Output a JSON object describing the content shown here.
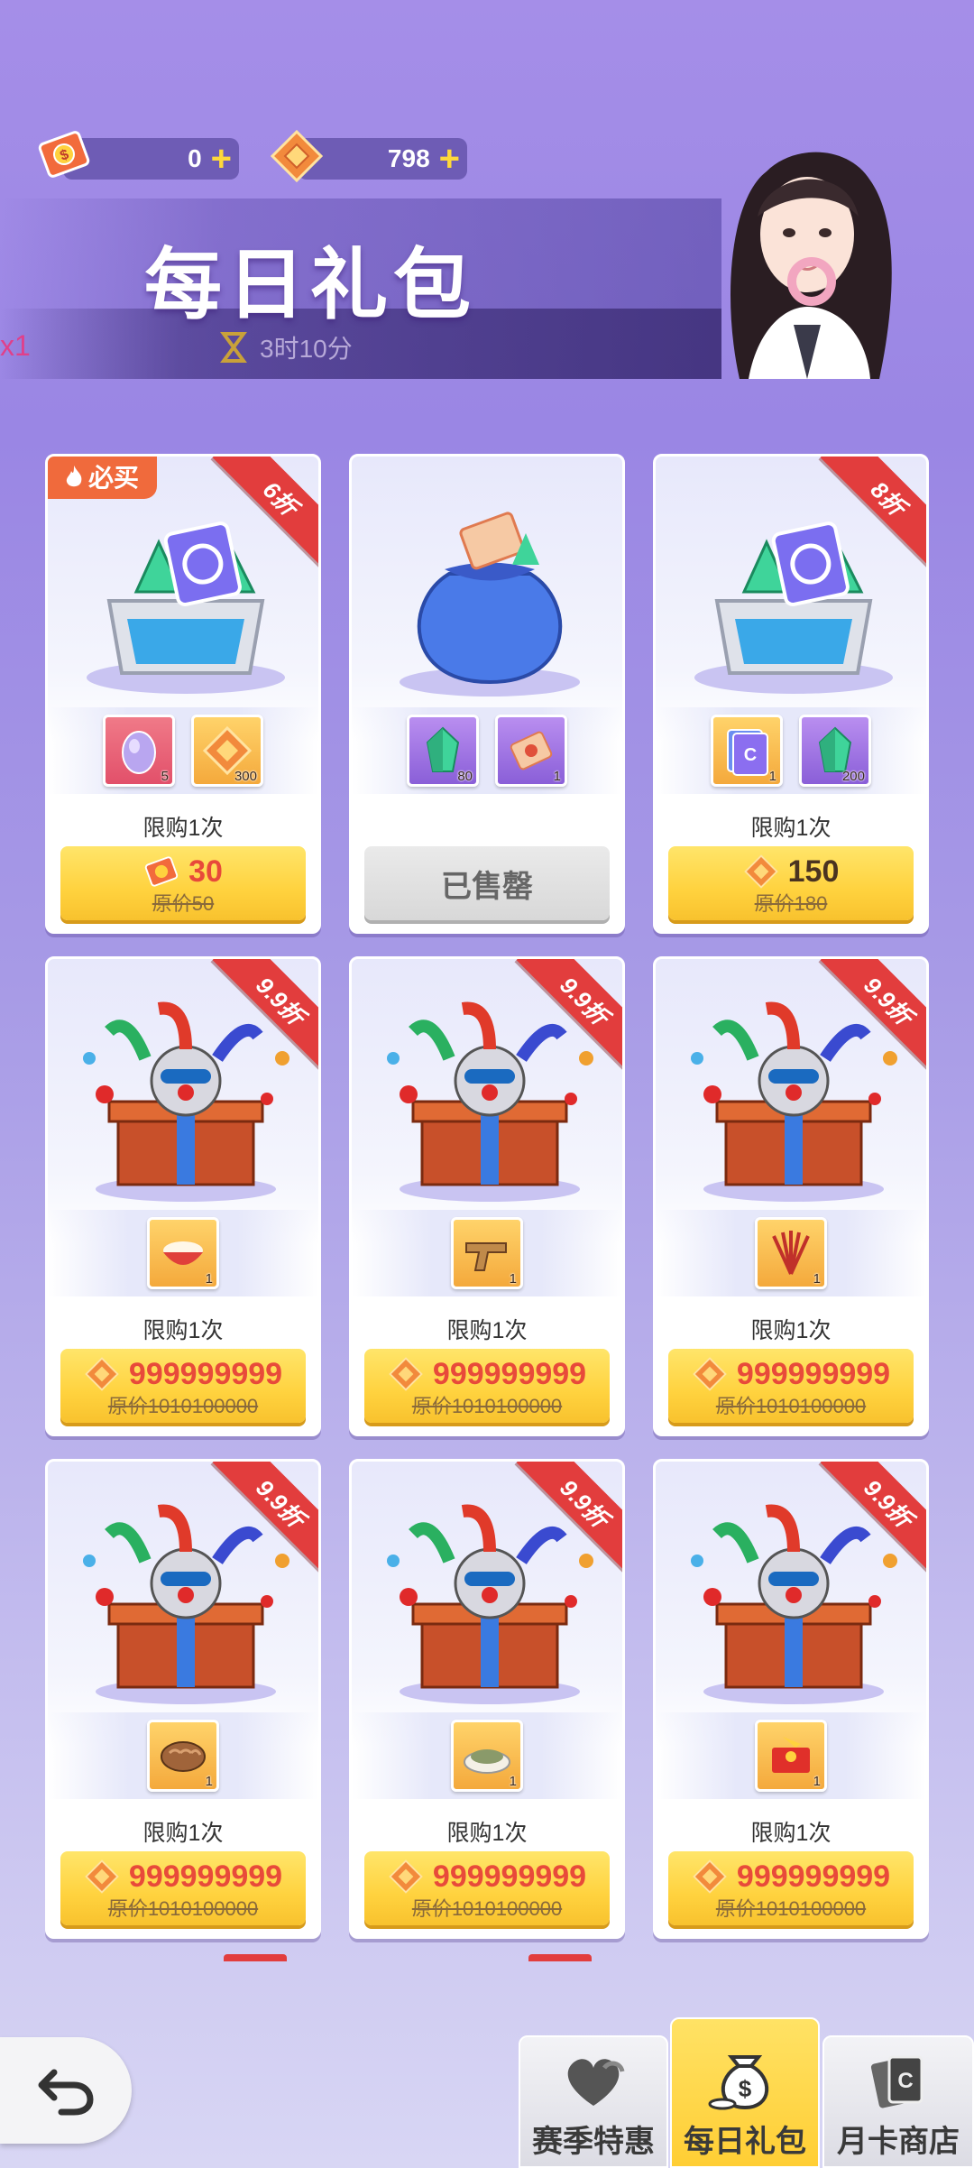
{
  "header": {
    "title": "每日礼包",
    "timer": "3时10分",
    "side_text": "x1",
    "currencies": [
      {
        "icon": "ticket-coin-icon",
        "value": "0"
      },
      {
        "icon": "diamond-coin-icon",
        "value": "798"
      }
    ],
    "plus_symbol": "+"
  },
  "cards": [
    {
      "badge": "必买",
      "discount": "6折",
      "art": "crystal-chest",
      "items": [
        {
          "icon": "egg-icon",
          "qty": "5",
          "bg": "red"
        },
        {
          "icon": "diamond-coin-icon",
          "qty": "300",
          "bg": "orange"
        }
      ],
      "limit": "限购1次",
      "price": "30",
      "currency": "ticket",
      "original": "原价50",
      "sold": false
    },
    {
      "badge": "",
      "discount": "",
      "art": "blue-bag",
      "items": [
        {
          "icon": "green-crystal-icon",
          "qty": "80",
          "bg": "purple"
        },
        {
          "icon": "ticket-icon",
          "qty": "1",
          "bg": "purple"
        }
      ],
      "limit": "",
      "price": "",
      "currency": "",
      "original": "",
      "sold": true,
      "sold_label": "已售罄"
    },
    {
      "badge": "",
      "discount": "8折",
      "art": "crystal-chest",
      "items": [
        {
          "icon": "card-pack-icon",
          "qty": "1",
          "bg": "orange"
        },
        {
          "icon": "green-crystal-icon",
          "qty": "200",
          "bg": "purple"
        }
      ],
      "limit": "限购1次",
      "price": "150",
      "currency": "diamond",
      "original": "原价180",
      "sold": false
    },
    {
      "badge": "",
      "discount": "9.9折",
      "art": "clown-gift",
      "items": [
        {
          "icon": "rice-bowl-icon",
          "qty": "1",
          "bg": "orange"
        }
      ],
      "limit": "限购1次",
      "price": "999999999",
      "currency": "diamond",
      "original": "原价1010100000",
      "sold": false
    },
    {
      "badge": "",
      "discount": "9.9折",
      "art": "clown-gift",
      "items": [
        {
          "icon": "pistol-icon",
          "qty": "1",
          "bg": "orange"
        }
      ],
      "limit": "限购1次",
      "price": "999999999",
      "currency": "diamond",
      "original": "原价1010100000",
      "sold": false
    },
    {
      "badge": "",
      "discount": "9.9折",
      "art": "clown-gift",
      "items": [
        {
          "icon": "feather-fan-icon",
          "qty": "1",
          "bg": "orange"
        }
      ],
      "limit": "限购1次",
      "price": "999999999",
      "currency": "diamond",
      "original": "原价1010100000",
      "sold": false
    },
    {
      "badge": "",
      "discount": "9.9折",
      "art": "clown-gift",
      "items": [
        {
          "icon": "bread-icon",
          "qty": "1",
          "bg": "orange"
        }
      ],
      "limit": "限购1次",
      "price": "999999999",
      "currency": "diamond",
      "original": "原价1010100000",
      "sold": false
    },
    {
      "badge": "",
      "discount": "9.9折",
      "art": "clown-gift",
      "items": [
        {
          "icon": "fish-dish-icon",
          "qty": "1",
          "bg": "orange"
        }
      ],
      "limit": "限购1次",
      "price": "999999999",
      "currency": "diamond",
      "original": "原价1010100000",
      "sold": false
    },
    {
      "badge": "",
      "discount": "9.9折",
      "art": "clown-gift",
      "items": [
        {
          "icon": "red-envelope-icon",
          "qty": "1",
          "bg": "orange"
        }
      ],
      "limit": "限购1次",
      "price": "999999999",
      "currency": "diamond",
      "original": "原价1010100000",
      "sold": false
    }
  ],
  "bottom_nav": {
    "back_icon": "back-arrow-icon",
    "tabs": [
      {
        "label": "赛季特惠",
        "icon": "heart-stack-icon",
        "active": false
      },
      {
        "label": "每日礼包",
        "icon": "money-bag-icon",
        "active": true
      },
      {
        "label": "月卡商店",
        "icon": "cards-icon",
        "active": false
      }
    ]
  },
  "colors": {
    "accent": "#ffd23e",
    "ribbon": "#e23d3d",
    "price_red": "#e84a3a",
    "badge": "#f06a3c"
  }
}
